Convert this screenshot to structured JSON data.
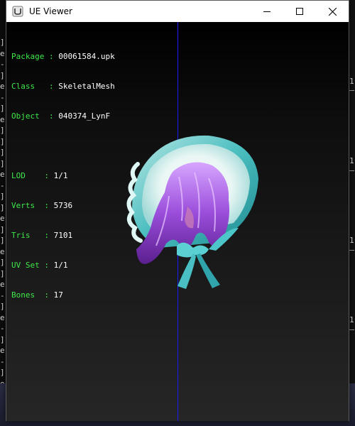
{
  "window": {
    "title": "UE Viewer"
  },
  "info_top": [
    {
      "label": "Package",
      "value": "00061584.upk"
    },
    {
      "label": "Class",
      "value": "SkeletalMesh"
    },
    {
      "label": "Object",
      "value": "040374_LynF"
    }
  ],
  "info_stats": [
    {
      "label": "LOD",
      "value": "1/1"
    },
    {
      "label": "Verts",
      "value": "5736"
    },
    {
      "label": "Tris",
      "value": "7101"
    },
    {
      "label": "UV Set",
      "value": "1/1"
    },
    {
      "label": "Bones",
      "value": "17"
    }
  ],
  "background": {
    "left_chars": [
      "]",
      "e",
      "-",
      "]",
      "e",
      "-",
      "]",
      "e",
      "]",
      "]",
      "]",
      "]",
      "e",
      "-",
      "]",
      "]",
      "e",
      "]",
      "]",
      "e",
      "]",
      "]",
      "e",
      "-",
      "]",
      "e",
      "-",
      "]",
      "e",
      "-",
      "]",
      "e",
      "]"
    ],
    "right_label": "1"
  },
  "colors": {
    "label_green": "#3ee84a",
    "axis_blue": "#1a1aff",
    "viewport_bg": "#000000"
  },
  "icons": {
    "app": "ue-viewer-app-icon",
    "min": "minimize-icon",
    "max": "maximize-icon",
    "close": "close-icon"
  }
}
